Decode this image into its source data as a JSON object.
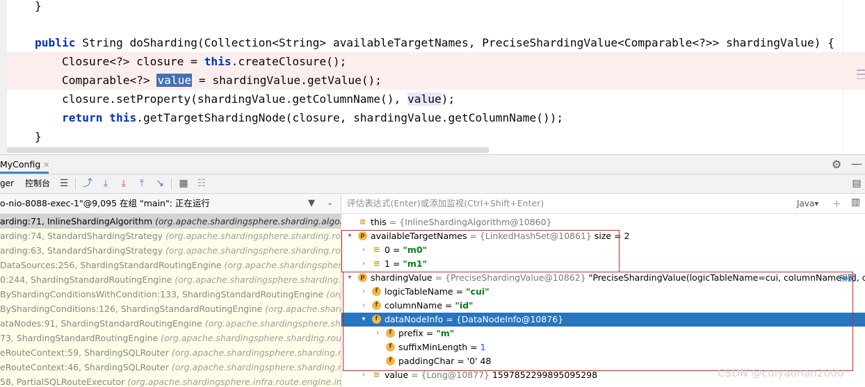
{
  "editor": {
    "lines": [
      {
        "text": "}"
      },
      {
        "segments": [
          {
            "t": "public",
            "kw": true
          },
          {
            "t": " String doSharding(Collection<String> availableTargetNames, PreciseShardingValue<Comparable<?>> shardingValue) {"
          }
        ]
      },
      {
        "segments": [
          {
            "t": "    Closure<?> closure = "
          },
          {
            "t": "this",
            "kw": true
          },
          {
            "t": ".createClosure();"
          }
        ]
      },
      {
        "segments": [
          {
            "t": "    Comparable<?> "
          },
          {
            "t": "value",
            "sel": true
          },
          {
            "t": " = shardingValue.getValue();"
          }
        ]
      },
      {
        "segments": [
          {
            "t": "    closure.setProperty(shardingValue.getColumnName(), "
          },
          {
            "t": "value",
            "ref": true
          },
          {
            "t": ");"
          }
        ]
      },
      {
        "segments": [
          {
            "t": "    "
          },
          {
            "t": "return",
            "kw": true
          },
          {
            "t": " "
          },
          {
            "t": "this",
            "kw": true
          },
          {
            "t": ".getTargetShardingNode(closure, shardingValue.getColumnName());"
          }
        ]
      },
      {
        "text": "}"
      }
    ]
  },
  "debug": {
    "run_tab": "MyConfig",
    "toolbar": {
      "debugger_tab": "ger",
      "console_tab": "控制台"
    },
    "thread": "o-nio-8088-exec-1\"@9,095 在组 \"main\": 正在运行",
    "eval_placeholder": "评估表达式(Enter)或添加监视(Ctrl+Shift+Enter)",
    "language": "Java▾",
    "frames": [
      {
        "method": "arding:71, InlineShardingAlgorithm ",
        "pkg": "(org.apache.shardingsphere.sharding.algorithm.s"
      },
      {
        "method": "arding:74, StandardShardingStrategy ",
        "pkg": "(org.apache.shardingsphere.sharding.route.stra"
      },
      {
        "method": "arding:63, StandardShardingStrategy ",
        "pkg": "(org.apache.shardingsphere.sharding.route.stra"
      },
      {
        "method": "DataSources:256, ShardingStandardRoutingEngine ",
        "pkg": "(org.apache.shardingsphere.shar"
      },
      {
        "method": "0:244, ShardingStandardRoutingEngine ",
        "pkg": "(org.apache.shardingsphere.sharding.route.eng"
      },
      {
        "method": "ByShardingConditionsWithCondition:133, ShardingStandardRoutingEngine ",
        "pkg": "(org.apac"
      },
      {
        "method": "ByShardingConditions:126, ShardingStandardRoutingEngine ",
        "pkg": "(org.apache.shardingsp"
      },
      {
        "method": "ataNodes:91, ShardingStandardRoutingEngine ",
        "pkg": "(org.apache.shardingsphere.sharding."
      },
      {
        "method": "73, ShardingStandardRoutingEngine ",
        "pkg": "(org.apache.shardingsphere.sharding.route.eng"
      },
      {
        "method": "eRouteContext:59, ShardingSQLRouter ",
        "pkg": "(org.apache.shardingsphere.sharding.route.en"
      },
      {
        "method": "eRouteContext:46, ShardingSQLRouter ",
        "pkg": "(org.apache.shardingsphere.sharding.route.en"
      },
      {
        "method": "58, PartialSQLRouteExecutor ",
        "pkg": "(org.apache.shardingsphere.infra.route.engine.impl)"
      }
    ],
    "variables": [
      {
        "indent": 0,
        "arrow": "",
        "icon": "lines",
        "name": "this",
        "obj": " = {InlineShardingAlgorithm@10860}",
        "rest": ""
      },
      {
        "indent": 0,
        "arrow": "▾",
        "icon": "p",
        "name": "availableTargetNames",
        "obj": " = {LinkedHashSet@10861}",
        "rest": "  size = 2"
      },
      {
        "indent": 1,
        "arrow": "›",
        "icon": "lines",
        "name": "0 = ",
        "str": "\"m0\"",
        "rest": ""
      },
      {
        "indent": 1,
        "arrow": "›",
        "icon": "lines",
        "name": "1 = ",
        "str": "\"m1\"",
        "rest": ""
      },
      {
        "indent": 0,
        "arrow": "▾",
        "icon": "p",
        "name": "shardingValue",
        "obj": " = {PreciseShardingValue@10862}",
        "rest": " \"PreciseShardingValue(logicTableName=cui, columnName=id, data...",
        "link": "视图"
      },
      {
        "indent": 1,
        "arrow": "›",
        "icon": "f",
        "name": "logicTableName = ",
        "str": "\"cui\"",
        "rest": ""
      },
      {
        "indent": 1,
        "arrow": "›",
        "icon": "f",
        "name": "columnName = ",
        "str": "\"id\"",
        "rest": ""
      },
      {
        "indent": 1,
        "arrow": "▾",
        "icon": "f",
        "name": "dataNodeInfo",
        "obj": " = {DataNodeInfo@10876}",
        "rest": "",
        "selected": true
      },
      {
        "indent": 2,
        "arrow": "›",
        "icon": "f",
        "name": "prefix = ",
        "str": "\"m\"",
        "rest": ""
      },
      {
        "indent": 2,
        "arrow": "",
        "icon": "f",
        "name": "suffixMinLength = ",
        "num": "1",
        "rest": ""
      },
      {
        "indent": 2,
        "arrow": "",
        "icon": "f",
        "name": "paddingChar = ",
        "rest": "'0' 48"
      },
      {
        "indent": 1,
        "arrow": "›",
        "icon": "lines",
        "name": "value",
        "obj": " = {Long@10877}",
        "rest": " 1597852299895095298"
      }
    ]
  },
  "watermark": "CSDN @cuiyaonan2000",
  "colors": {
    "keyword": "#0033b3",
    "selection": "#4570b3",
    "current_line": "#fbeeec",
    "tree_selected": "#2675bf",
    "annotation_box": "#e02020"
  }
}
